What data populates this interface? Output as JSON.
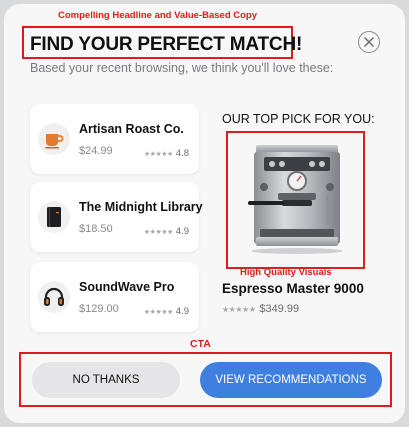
{
  "annotations": {
    "headline_note": "Compelling Headline and Value-Based Copy",
    "visuals_note": "High Quality Visuals",
    "cta_note": "CTA",
    "color": "#e01b1b"
  },
  "modal": {
    "headline": "FIND YOUR PERFECT MATCH!",
    "subtitle": "Based your recent browsing,   we think you'll love these:",
    "close_icon": "close-icon"
  },
  "recommendations": [
    {
      "title": "Artisan Roast Co.",
      "price": "$24.99",
      "stars": "★★★★★",
      "rating": "4.8",
      "icon": "coffee-cup-icon",
      "icon_color": "#e07a2e"
    },
    {
      "title": "The Midnight Library",
      "price": "$18.50",
      "stars": "★★★★★",
      "rating": "4.9",
      "icon": "book-icon",
      "icon_color": "#1e1e22"
    },
    {
      "title": "SoundWave Pro",
      "price": "$129.00",
      "stars": "★★★★★",
      "rating": "4.9",
      "icon": "headphones-icon",
      "icon_color": "#222"
    }
  ],
  "top_pick": {
    "label": "OUR TOP PICK FOR YOU:",
    "name": "Espresso Master 9000",
    "stars": "★★★★★",
    "price": "$349.99",
    "image": "espresso-machine-image"
  },
  "actions": {
    "no_thanks": "NO THANKS",
    "view": "VIEW RECOMMENDATIONS",
    "primary_color": "#3f7fe0"
  }
}
